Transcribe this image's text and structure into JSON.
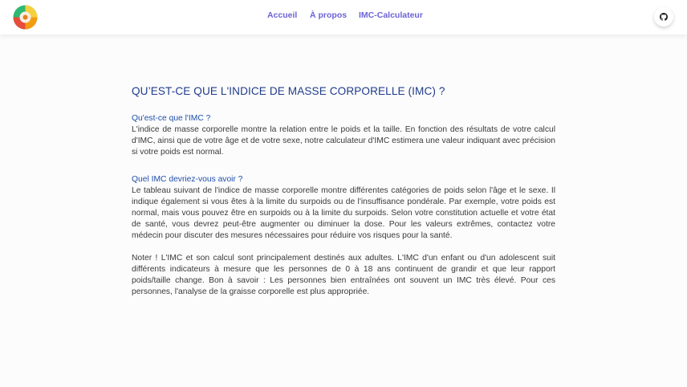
{
  "nav": {
    "links": [
      "Accueil",
      "À propos",
      "IMC-Calculateur"
    ]
  },
  "icons": {
    "logo": "bmi-gauge-logo",
    "github": "github-icon"
  },
  "colors": {
    "nav_link": "#6b63d6",
    "heading": "#1f3c88",
    "subheading": "#1f4fa8",
    "text": "#3a3a3a"
  },
  "main": {
    "title": "QU’EST-CE QUE L'INDICE DE MASSE CORPORELLE (IMC) ?",
    "sections": [
      {
        "heading": "Qu'est-ce que l'IMC ?",
        "text": "L'indice de masse corporelle montre la relation entre le poids et la taille. En fonction des résultats de votre calcul d'IMC, ainsi que de votre âge et de votre sexe, notre calculateur d'IMC estimera une valeur indiquant avec précision si votre poids est normal."
      },
      {
        "heading": "Quel IMC devriez-vous avoir ?",
        "text": "Le tableau suivant de l'indice de masse corporelle montre différentes catégories de poids selon l'âge et le sexe. Il indique également si vous êtes à la limite du surpoids ou de l'insuffisance pondérale. Par exemple, votre poids est normal, mais vous pouvez être en surpoids ou à la limite du surpoids. Selon votre constitution actuelle et votre état de santé, vous devrez peut-être augmenter ou diminuer la dose. Pour les valeurs extrêmes, contactez votre médecin pour discuter des mesures nécessaires pour réduire vos risques pour la santé."
      }
    ],
    "note": "Noter ! L'IMC et son calcul sont principalement destinés aux adultes. L'IMC d'un enfant ou d'un adolescent suit différents indicateurs à mesure que les personnes de 0 à 18 ans continuent de grandir et que leur rapport poids/taille change. Bon à savoir : Les personnes bien entraînées ont souvent un IMC très élevé. Pour ces personnes, l'analyse de la graisse corporelle est plus appropriée."
  }
}
